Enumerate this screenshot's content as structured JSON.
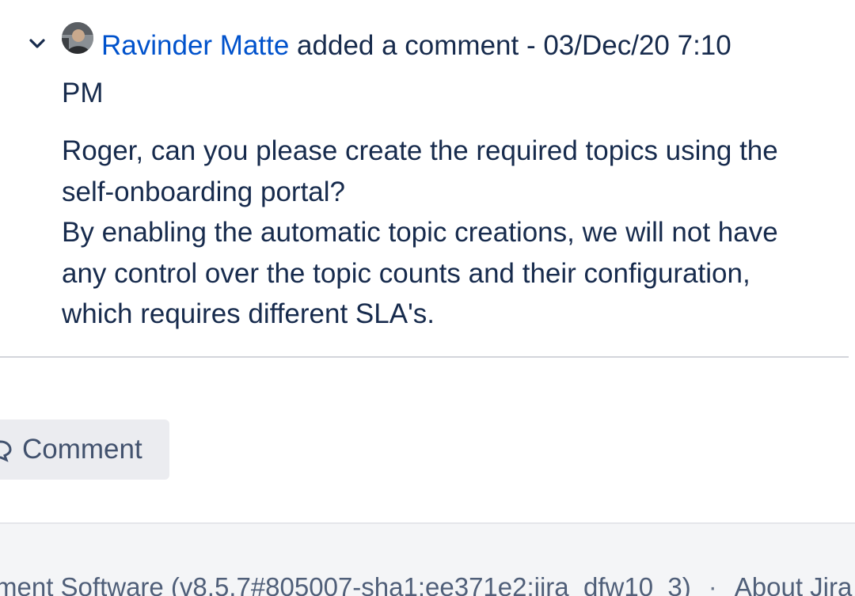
{
  "comment": {
    "author": "Ravinder Matte",
    "action": " added a comment - 03/Dec/20 7:10 PM",
    "avatar_icon": "user-avatar",
    "toggle_icon": "chevron-down-icon",
    "body": [
      "Roger, can you please create the required topics using the self-onboarding portal?",
      "By enabling the automatic topic creations, we will not have any control over the topic counts and their configuration, which requires different SLA's."
    ]
  },
  "actions": {
    "comment_button_label": "Comment",
    "comment_icon": "comment-icon"
  },
  "footer": {
    "software_link": "ment Software",
    "version_text": " (v8.5.7#805007-sha1:ee371e2:jira_dfw10_3)",
    "separator": "·",
    "about_link": "About Jira",
    "trailing_separator": "·"
  },
  "colors": {
    "link_blue": "#0052cc",
    "text": "#172b4d",
    "button_bg": "#ebecf0",
    "footer_bg": "#f4f5f7",
    "divider": "#d3d5db"
  }
}
